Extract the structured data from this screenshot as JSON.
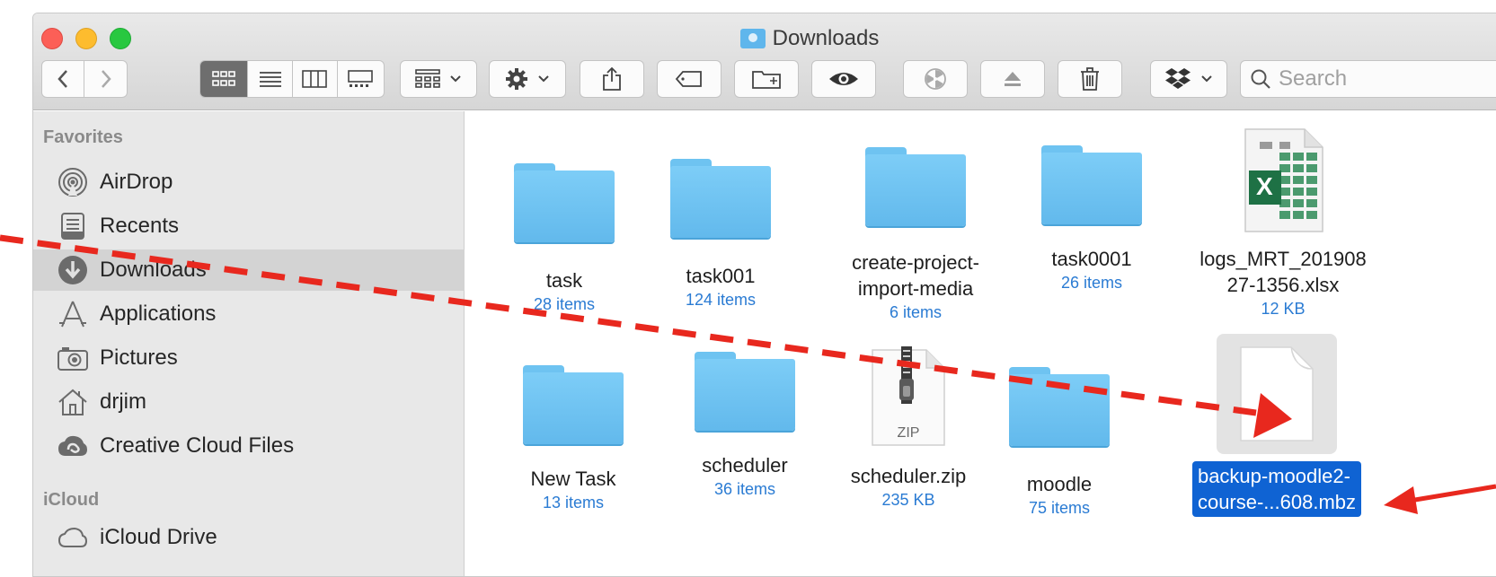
{
  "window": {
    "title": "Downloads"
  },
  "toolbar": {
    "back_icon": "chevron-left-icon",
    "forward_icon": "chevron-right-icon",
    "views": [
      "icon-view-icon",
      "list-view-icon",
      "column-view-icon",
      "gallery-view-icon"
    ],
    "group_icon": "group-by-icon",
    "action_icon": "gear-icon",
    "share_icon": "share-icon",
    "tag_icon": "tag-icon",
    "new_folder_icon": "new-folder-icon",
    "quicklook_icon": "eye-icon",
    "burn_icon": "burn-icon",
    "eject_icon": "eject-icon",
    "trash_icon": "trash-icon",
    "dropbox_icon": "dropbox-icon",
    "search_placeholder": "Search"
  },
  "sidebar": {
    "favorites_heading": "Favorites",
    "items": [
      {
        "label": "AirDrop",
        "icon": "airdrop-icon"
      },
      {
        "label": "Recents",
        "icon": "recents-icon"
      },
      {
        "label": "Downloads",
        "icon": "downloads-icon",
        "selected": true
      },
      {
        "label": "Applications",
        "icon": "applications-icon"
      },
      {
        "label": "Pictures",
        "icon": "pictures-icon"
      },
      {
        "label": "drjim",
        "icon": "home-icon"
      },
      {
        "label": "Creative Cloud Files",
        "icon": "creative-cloud-icon"
      }
    ],
    "icloud_heading": "iCloud",
    "icloud_items": [
      {
        "label": "iCloud Drive",
        "icon": "cloud-icon"
      }
    ]
  },
  "files": [
    {
      "name": "task",
      "meta": "28 items",
      "kind": "folder"
    },
    {
      "name": "task001",
      "meta": "124 items",
      "kind": "folder"
    },
    {
      "name_line1": "create-project-",
      "name_line2": "import-media",
      "meta": "6 items",
      "kind": "folder"
    },
    {
      "name": "task0001",
      "meta": "26 items",
      "kind": "folder"
    },
    {
      "name_line1": "logs_MRT_201908",
      "name_line2": "27-1356.xlsx",
      "meta": "12 KB",
      "kind": "excel"
    },
    {
      "name": "New Task",
      "meta": "13 items",
      "kind": "folder"
    },
    {
      "name": "scheduler",
      "meta": "36 items",
      "kind": "folder"
    },
    {
      "name": "scheduler.zip",
      "meta": "235 KB",
      "kind": "zip",
      "badge": "ZIP"
    },
    {
      "name": "moodle",
      "meta": "75 items",
      "kind": "folder"
    },
    {
      "name_line1": "backup-moodle2-",
      "name_line2": "course-...608.mbz",
      "kind": "document",
      "selected": true
    }
  ],
  "excel_badge": "X",
  "colors": {
    "annotation": "#e8281e",
    "selection": "#0f63d3",
    "folder": "#6ec3f1",
    "meta_text": "#2a7bd3"
  }
}
